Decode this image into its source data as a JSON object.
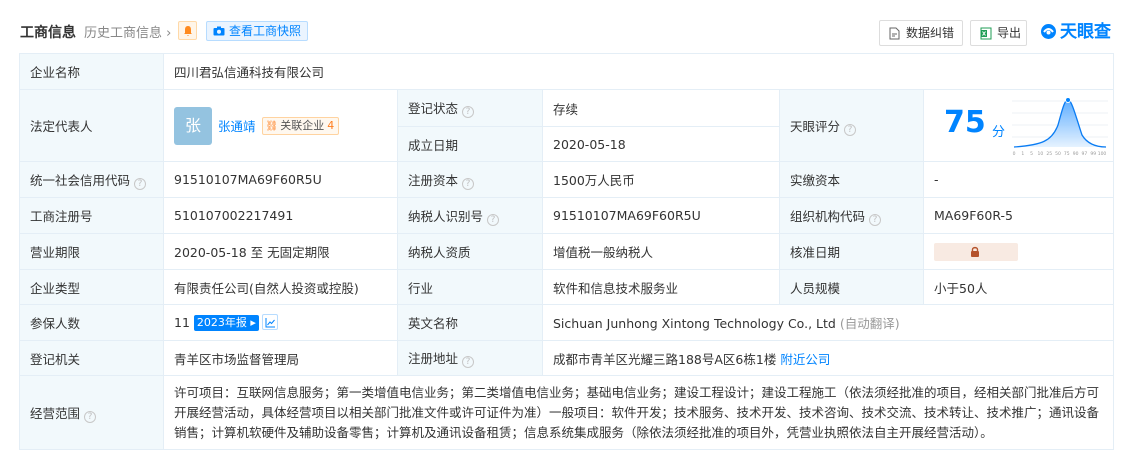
{
  "header": {
    "title": "工商信息",
    "history_link": "历史工商信息",
    "snapshot_button": "查看工商快照",
    "fix_button": "数据纠错",
    "export_button": "导出",
    "logo": "天眼查"
  },
  "colors": {
    "accent": "#0084ff",
    "status_green": "#16b05c",
    "label_bg": "#f2f9fc",
    "border": "#e4eef6"
  },
  "rows": {
    "company_name": {
      "label": "企业名称",
      "value": "四川君弘信通科技有限公司"
    },
    "legal_rep": {
      "label": "法定代表人",
      "avatar_char": "张",
      "name": "张通靖",
      "related_label": "关联企业",
      "related_count": "4"
    },
    "reg_status": {
      "label": "登记状态",
      "value": "存续"
    },
    "established": {
      "label": "成立日期",
      "value": "2020-05-18"
    },
    "score": {
      "label": "天眼评分",
      "value": "75",
      "unit": "分",
      "axis_ticks": [
        "0",
        "1",
        "5",
        "10",
        "25",
        "50",
        "75",
        "90",
        "97",
        "99",
        "100"
      ]
    },
    "credit_code": {
      "label": "统一社会信用代码",
      "value": "91510107MA69F60R5U"
    },
    "reg_capital": {
      "label": "注册资本",
      "value": "1500万人民币"
    },
    "paid_capital": {
      "label": "实缴资本",
      "value": "-"
    },
    "reg_number": {
      "label": "工商注册号",
      "value": "510107002217491"
    },
    "taxpayer_id": {
      "label": "纳税人识别号",
      "value": "91510107MA69F60R5U"
    },
    "org_code": {
      "label": "组织机构代码",
      "value": "MA69F60R-5"
    },
    "term": {
      "label": "营业期限",
      "value": "2020-05-18 至 无固定期限"
    },
    "taxpayer_type": {
      "label": "纳税人资质",
      "value": "增值税一般纳税人"
    },
    "approval_date": {
      "label": "核准日期"
    },
    "company_type": {
      "label": "企业类型",
      "value": "有限责任公司(自然人投资或控股)"
    },
    "industry": {
      "label": "行业",
      "value": "软件和信息技术服务业"
    },
    "staff_size": {
      "label": "人员规模",
      "value": "小于50人"
    },
    "insured": {
      "label": "参保人数",
      "value": "11",
      "year_tag": "2023年报"
    },
    "english_name": {
      "label": "英文名称",
      "value": "Sichuan Junhong Xintong Technology Co., Ltd",
      "note": "(自动翻译)"
    },
    "authority": {
      "label": "登记机关",
      "value": "青羊区市场监督管理局"
    },
    "address": {
      "label": "注册地址",
      "value": "成都市青羊区光耀三路188号A区6栋1楼",
      "nearby": "附近公司"
    },
    "scope": {
      "label": "经营范围",
      "value": "许可项目：互联网信息服务；第一类增值电信业务；第二类增值电信业务；基础电信业务；建设工程设计；建设工程施工（依法须经批准的项目，经相关部门批准后方可开展经营活动，具体经营项目以相关部门批准文件或许可证件为准）一般项目：软件开发；技术服务、技术开发、技术咨询、技术交流、技术转让、技术推广；通讯设备销售；计算机软硬件及辅助设备零售；计算机及通讯设备租赁；信息系统集成服务（除依法须经批准的项目外，凭营业执照依法自主开展经营活动）。"
    }
  }
}
